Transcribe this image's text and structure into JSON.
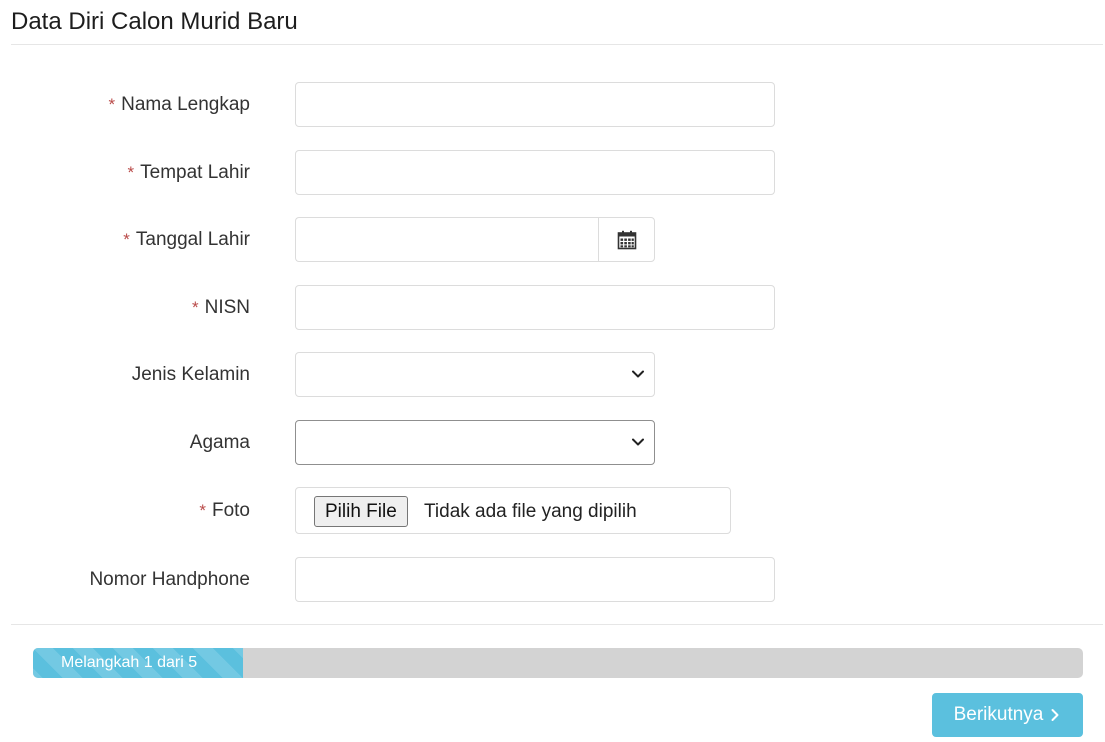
{
  "header": {
    "title": "Data Diri Calon Murid Baru"
  },
  "form": {
    "required_mark": "*",
    "nama_lengkap": {
      "label": "Nama Lengkap",
      "value": ""
    },
    "tempat_lahir": {
      "label": "Tempat Lahir",
      "value": ""
    },
    "tanggal_lahir": {
      "label": "Tanggal Lahir",
      "value": "",
      "icon": "calendar-icon"
    },
    "nisn": {
      "label": "NISN",
      "value": ""
    },
    "jenis_kelamin": {
      "label": "Jenis Kelamin",
      "value": "",
      "icon": "chevron-down-icon"
    },
    "agama": {
      "label": "Agama",
      "value": "",
      "icon": "chevron-down-icon"
    },
    "foto": {
      "label": "Foto",
      "button_label": "Pilih File",
      "status": "Tidak ada file yang dipilih"
    },
    "nomor_handphone": {
      "label": "Nomor Handphone",
      "value": ""
    }
  },
  "progress": {
    "label": "Melangkah 1 dari 5",
    "current_step": 1,
    "total_steps": 5,
    "color": "#5bc0de"
  },
  "footer": {
    "next_label": "Berikutnya",
    "next_icon": "chevron-right-icon"
  }
}
